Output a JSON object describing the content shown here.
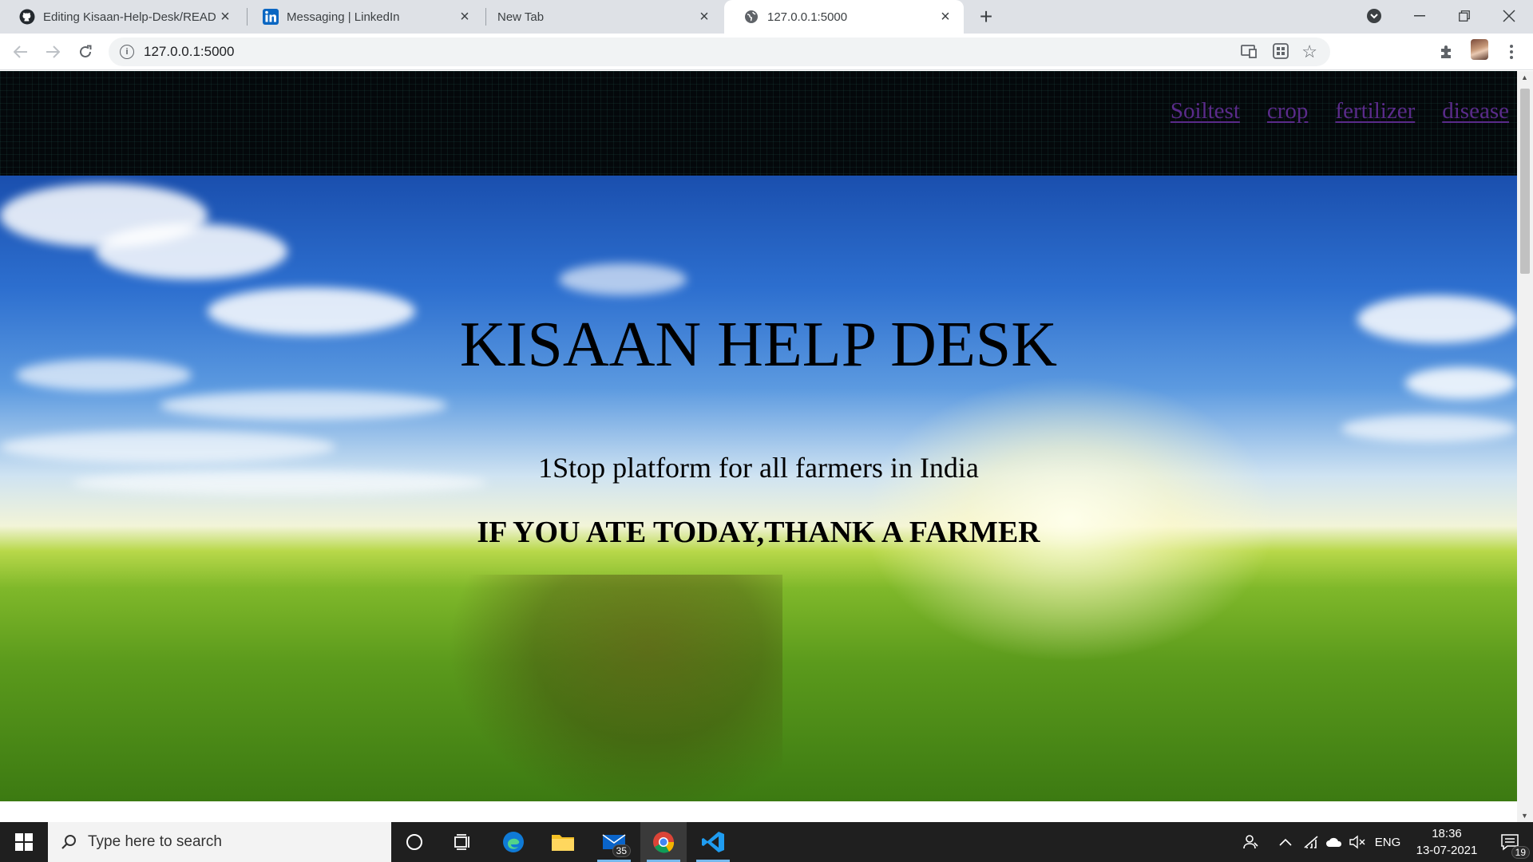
{
  "tabs": [
    {
      "title": "Editing Kisaan-Help-Desk/README",
      "icon": "github-icon"
    },
    {
      "title": "Messaging | LinkedIn",
      "icon": "linkedin-icon"
    },
    {
      "title": "New Tab",
      "icon": ""
    },
    {
      "title": "127.0.0.1:5000",
      "icon": "globe-icon"
    }
  ],
  "address_bar": {
    "url": "127.0.0.1:5000"
  },
  "navbar": {
    "links": [
      "Soiltest",
      "crop",
      "fertilizer",
      "disease"
    ]
  },
  "hero": {
    "title": "KISAAN HELP DESK",
    "subtitle": "1Stop platform for all farmers in India",
    "quote": "IF YOU ATE TODAY,THANK A FARMER"
  },
  "taskbar": {
    "search_placeholder": "Type here to search",
    "mail_badge": "35",
    "language": "ENG",
    "time": "18:36",
    "date": "13-07-2021",
    "notification_count": "19"
  },
  "colors": {
    "navbar_bg": "#04080b",
    "nav_link": "#5a2b8a",
    "tabstrip_bg": "#dee1e6"
  }
}
